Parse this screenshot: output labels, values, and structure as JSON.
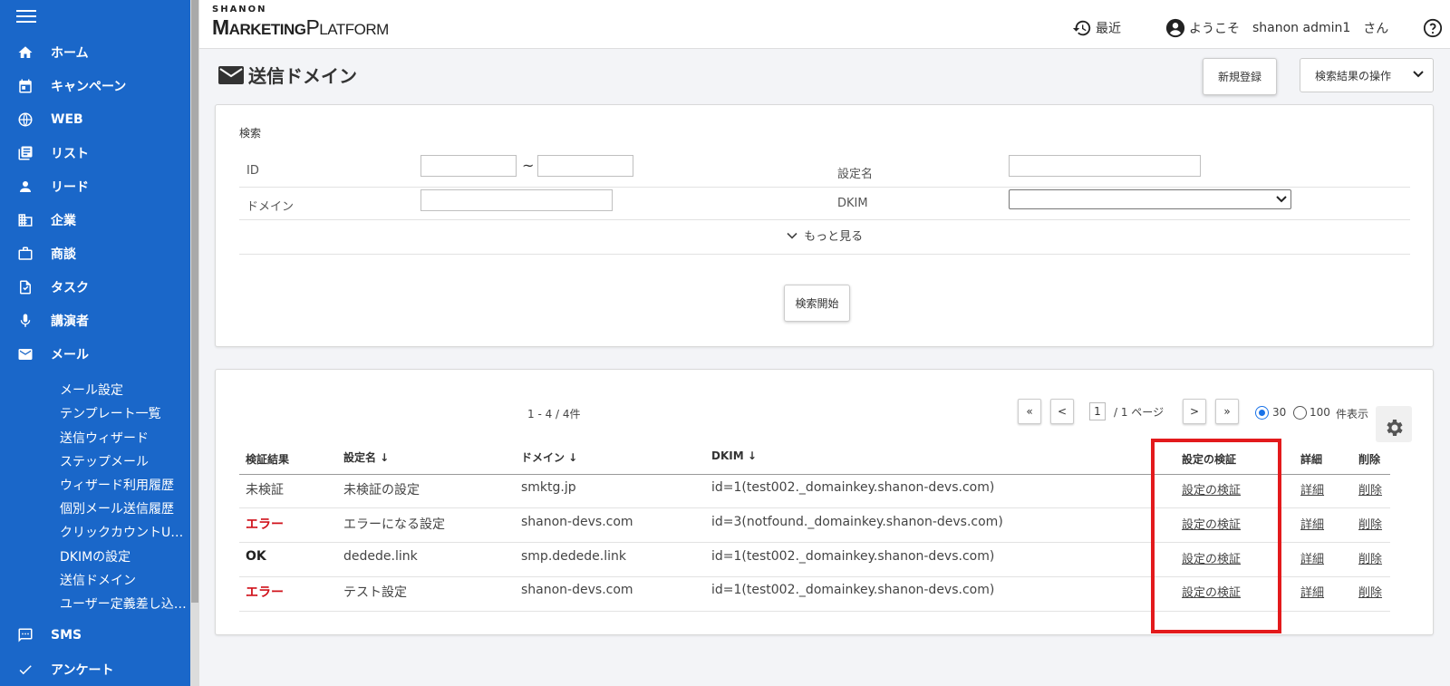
{
  "sidebar": {
    "items": [
      {
        "label": "ホーム",
        "icon": "home-icon"
      },
      {
        "label": "キャンペーン",
        "icon": "calendar-icon"
      },
      {
        "label": "WEB",
        "icon": "globe-icon"
      },
      {
        "label": "リスト",
        "icon": "list-icon"
      },
      {
        "label": "リード",
        "icon": "person-icon"
      },
      {
        "label": "企業",
        "icon": "building-icon"
      },
      {
        "label": "商談",
        "icon": "briefcase-icon"
      },
      {
        "label": "タスク",
        "icon": "task-icon"
      },
      {
        "label": "講演者",
        "icon": "mic-icon"
      },
      {
        "label": "メール",
        "icon": "mail-icon"
      },
      {
        "label": "SMS",
        "icon": "sms-icon"
      },
      {
        "label": "アンケート",
        "icon": "check-icon"
      }
    ],
    "mail_sub": [
      "メール設定",
      "テンプレート一覧",
      "送信ウィザード",
      "ステップメール",
      "ウィザード利用履歴",
      "個別メール送信履歴",
      "クリックカウントU…",
      "DKIMの設定",
      "送信ドメイン",
      "ユーザー定義差し込…"
    ]
  },
  "header": {
    "logo_small": "SHANON",
    "logo_main_1": "M",
    "logo_main_2": "ARKETING",
    "logo_main_3": "P",
    "logo_main_4": "LATFORM",
    "recent": "最近",
    "welcome": "ようこそ",
    "user": "shanon admin1",
    "honorific": "さん"
  },
  "page": {
    "title": "送信ドメイン",
    "new_button": "新規登録",
    "result_ops": "検索結果の操作"
  },
  "search": {
    "section_label": "検索",
    "id_label": "ID",
    "tilde": "~",
    "setting_name_label": "設定名",
    "domain_label": "ドメイン",
    "dkim_label": "DKIM",
    "more": "もっと見る",
    "submit": "検索開始"
  },
  "results": {
    "count": "1 - 4 / 4件",
    "page_current": "1",
    "page_total": "/ 1 ページ",
    "first": "«",
    "prev": "<",
    "next": ">",
    "last": "»",
    "per_page_30": "30",
    "per_page_100": "100",
    "per_page_suffix": "件表示",
    "headers": {
      "result": "検証結果",
      "name": "設定名 ↓",
      "domain": "ドメイン ↓",
      "dkim": "DKIM ↓",
      "verify": "設定の検証",
      "detail": "詳細",
      "delete": "削除"
    },
    "rows": [
      {
        "result": "未検証",
        "name": "未検証の設定",
        "domain": "smktg.jp",
        "dkim": "id=1(test002._domainkey.shanon-devs.com)",
        "verify": "設定の検証",
        "detail": "詳細",
        "delete": "削除"
      },
      {
        "result": "エラー",
        "name": "エラーになる設定",
        "domain": "shanon-devs.com",
        "dkim": "id=3(notfound._domainkey.shanon-devs.com)",
        "verify": "設定の検証",
        "detail": "詳細",
        "delete": "削除"
      },
      {
        "result": "OK",
        "name": "dedede.link",
        "domain": "smp.dedede.link",
        "dkim": "id=1(test002._domainkey.shanon-devs.com)",
        "verify": "設定の検証",
        "detail": "詳細",
        "delete": "削除"
      },
      {
        "result": "エラー",
        "name": "テスト設定",
        "domain": "shanon-devs.com",
        "dkim": "id=1(test002._domainkey.shanon-devs.com)",
        "verify": "設定の検証",
        "detail": "詳細",
        "delete": "削除"
      }
    ]
  },
  "colors": {
    "sidebar_bg": "#1a67c9",
    "error": "#d0121b",
    "highlight": "#e31a1c",
    "radio_active": "#1a73e8"
  }
}
